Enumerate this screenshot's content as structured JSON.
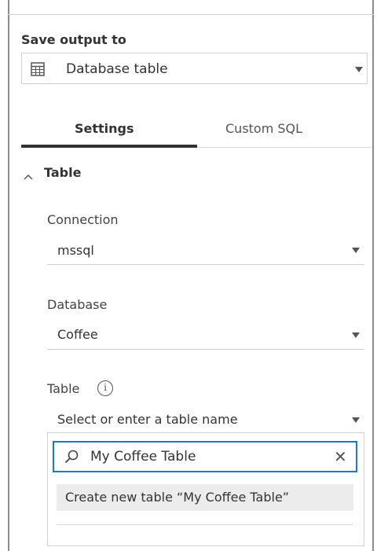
{
  "output": {
    "label": "Save output to",
    "selected": "Database table",
    "icon": "table-icon"
  },
  "tabs": [
    {
      "label": "Settings",
      "active": true
    },
    {
      "label": "Custom SQL",
      "active": false
    }
  ],
  "section": {
    "title": "Table",
    "expanded": true,
    "fields": {
      "connection": {
        "label": "Connection",
        "value": "mssql"
      },
      "database": {
        "label": "Database",
        "value": "Coffee"
      },
      "table": {
        "label": "Table",
        "placeholder": "Select or enter a table name"
      }
    }
  },
  "dropdown": {
    "search_value": "My Coffee Table",
    "create_option": "Create new table “My Coffee Table”"
  },
  "colors": {
    "focus_border": "#1f77c8",
    "active_tab": "#333333",
    "highlight": "#ececec"
  }
}
